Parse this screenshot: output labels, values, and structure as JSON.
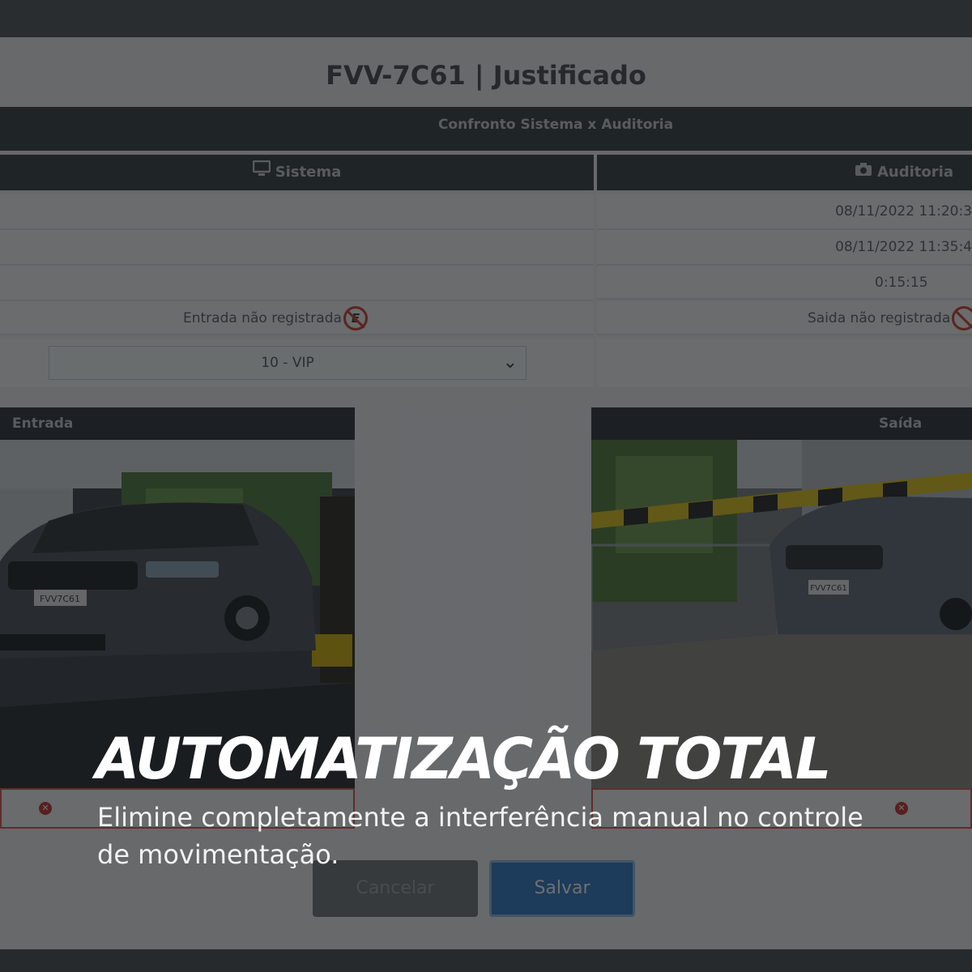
{
  "modal": {
    "title": "FVV-7C61 | Justificado",
    "section_title": "Confronto Sistema x Auditoria",
    "col_sistema": "Sistema",
    "col_auditoria": "Auditoria",
    "sistema_entry_status": "Entrada não registrada",
    "sistema_entry_icon": "E",
    "auditoria_entry_time": "08/11/2022 11:20:3",
    "auditoria_exit_time": "08/11/2022 11:35:4",
    "auditoria_duration": "0:15:15",
    "auditoria_exit_status": "Saida não registrada",
    "category_select": "10 - VIP",
    "panel_entrada": "Entrada",
    "panel_saida": "Saída",
    "plate_entrada": "FVV7C61",
    "plate_saida": "FVV7C61"
  },
  "buttons": {
    "cancel": "Cancelar",
    "save": "Salvar"
  },
  "promo": {
    "headline": "AUTOMATIZAÇÃO TOTAL",
    "subline": "Elimine completamente a interferência manual no controle de movimentação."
  },
  "colors": {
    "header": "#333a41",
    "save": "#2f78c6",
    "error": "#d9534f"
  }
}
